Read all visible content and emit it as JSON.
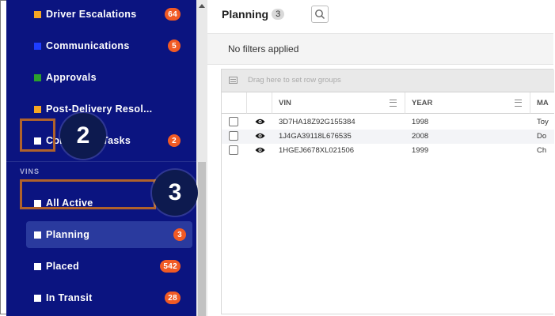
{
  "sidebar": {
    "items": [
      {
        "label": "Driver Escalations",
        "color": "#f5a623",
        "badge": "64"
      },
      {
        "label": "Communications",
        "color": "#1e3dff",
        "badge": "5"
      },
      {
        "label": "Approvals",
        "color": "#2ca02c",
        "badge": ""
      },
      {
        "label": "Post-Delivery Resol...",
        "color": "#f5a623",
        "badge": ""
      },
      {
        "label": "Completed Tasks",
        "color": "#ffffff",
        "badge": "2"
      }
    ],
    "section_label": "VINS",
    "vins": [
      {
        "label": "All Active",
        "badge": ""
      },
      {
        "label": "Planning",
        "badge": "3",
        "active": true
      },
      {
        "label": "Placed",
        "badge": "542"
      },
      {
        "label": "In Transit",
        "badge": "28"
      }
    ]
  },
  "main": {
    "title": "Planning",
    "count": "3",
    "filter_text": "No filters applied",
    "group_hint": "Drag here to set row groups",
    "columns": [
      "VIN",
      "YEAR",
      "MA"
    ],
    "rows": [
      {
        "vin": "3D7HA18Z92G155384",
        "year": "1998",
        "make": "Toy"
      },
      {
        "vin": "1J4GA39118L676535",
        "year": "2008",
        "make": "Do"
      },
      {
        "vin": "1HGEJ6678XL021506",
        "year": "1999",
        "make": "Ch"
      }
    ]
  },
  "annotations": {
    "step2": "2",
    "step3": "3",
    "color": "#b0622b"
  }
}
